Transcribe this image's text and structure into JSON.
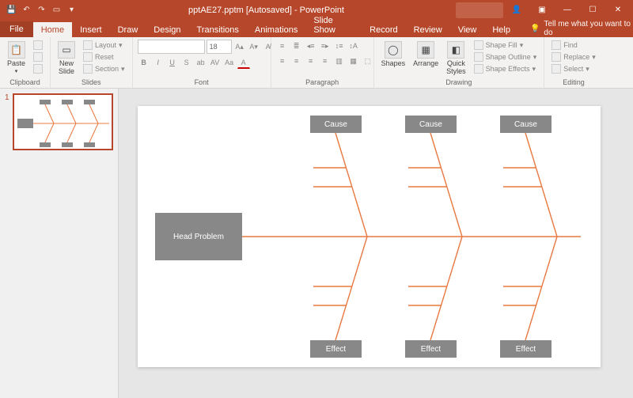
{
  "title": "pptAE27.pptm [Autosaved] - PowerPoint",
  "tabs": {
    "file": "File",
    "home": "Home",
    "insert": "Insert",
    "draw": "Draw",
    "design": "Design",
    "transitions": "Transitions",
    "animations": "Animations",
    "slideshow": "Slide Show",
    "record": "Record",
    "review": "Review",
    "view": "View",
    "help": "Help"
  },
  "tellme": "Tell me what you want to do",
  "ribbon": {
    "clipboard": {
      "label": "Clipboard",
      "paste": "Paste",
      "cut": "Cut",
      "copy": "Copy",
      "painter": "Format Painter"
    },
    "slides": {
      "label": "Slides",
      "new": "New\nSlide",
      "layout": "Layout",
      "reset": "Reset",
      "section": "Section"
    },
    "font": {
      "label": "Font",
      "size": "18"
    },
    "paragraph": {
      "label": "Paragraph"
    },
    "drawing": {
      "label": "Drawing",
      "shapes": "Shapes",
      "arrange": "Arrange",
      "quick": "Quick\nStyles",
      "fill": "Shape Fill",
      "outline": "Shape Outline",
      "effects": "Shape Effects"
    },
    "editing": {
      "label": "Editing",
      "find": "Find",
      "replace": "Replace",
      "select": "Select"
    }
  },
  "thumb_num": "1",
  "diagram": {
    "head": "Head Problem",
    "cause": "Cause",
    "effect": "Effect"
  }
}
